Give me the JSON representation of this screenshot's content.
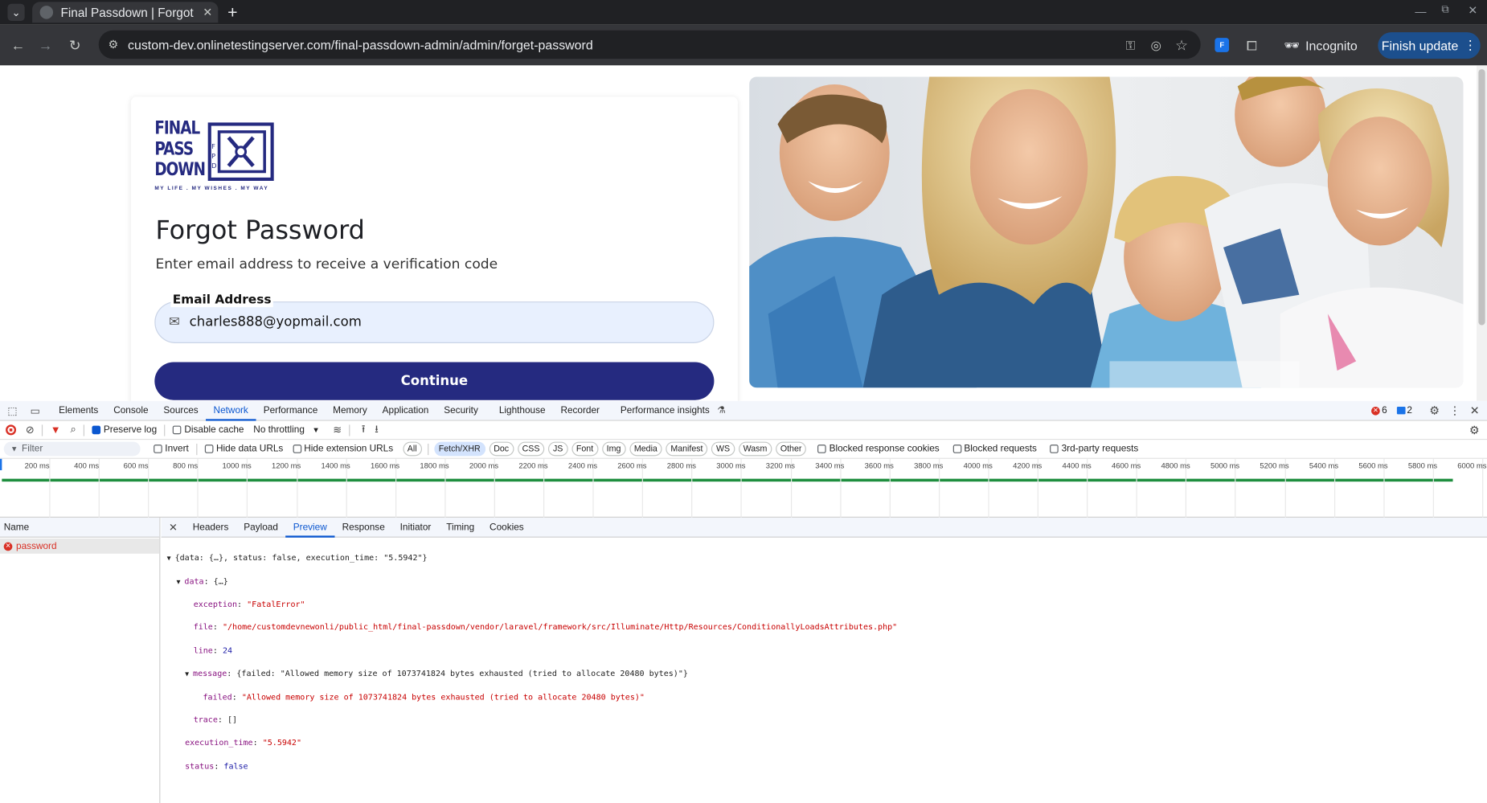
{
  "browser": {
    "tab_title": "Final Passdown | Forgot P",
    "url": "custom-dev.onlinetestingserver.com/final-passdown-admin/admin/forget-password",
    "incognito_label": "Incognito",
    "finish_update_label": "Finish update"
  },
  "page": {
    "logo": {
      "line1": "FINAL",
      "line2": "PASS",
      "line3": "DOWN",
      "tagline": "MY LIFE . MY WISHES . MY WAY"
    },
    "title": "Forgot Password",
    "subtitle": "Enter email address to receive a verification code",
    "email_label": "Email Address",
    "email_value": "charles888@yopmail.com",
    "continue_label": "Continue"
  },
  "devtools": {
    "tabs": [
      "Elements",
      "Console",
      "Sources",
      "Network",
      "Performance",
      "Memory",
      "Application",
      "Security",
      "Lighthouse",
      "Recorder",
      "Performance insights"
    ],
    "active_tab": "Network",
    "errors_count": "6",
    "messages_count": "2",
    "preserve_log": "Preserve log",
    "disable_cache": "Disable cache",
    "throttling": "No throttling",
    "filter_placeholder": "Filter",
    "invert": "Invert",
    "hide_data_urls": "Hide data URLs",
    "hide_extension_urls": "Hide extension URLs",
    "type_filters": [
      "All",
      "Fetch/XHR",
      "Doc",
      "CSS",
      "JS",
      "Font",
      "Img",
      "Media",
      "Manifest",
      "WS",
      "Wasm",
      "Other"
    ],
    "selected_type": "Fetch/XHR",
    "blocked_response_cookies": "Blocked response cookies",
    "blocked_requests": "Blocked requests",
    "third_party": "3rd-party requests",
    "timeline_ticks": [
      "200 ms",
      "400 ms",
      "600 ms",
      "800 ms",
      "1000 ms",
      "1200 ms",
      "1400 ms",
      "1600 ms",
      "1800 ms",
      "2000 ms",
      "2200 ms",
      "2400 ms",
      "2600 ms",
      "2800 ms",
      "3000 ms",
      "3200 ms",
      "3400 ms",
      "3600 ms",
      "3800 ms",
      "4000 ms",
      "4200 ms",
      "4400 ms",
      "4600 ms",
      "4800 ms",
      "5000 ms",
      "5200 ms",
      "5400 ms",
      "5600 ms",
      "5800 ms",
      "6000 ms"
    ],
    "name_header": "Name",
    "request_name": "password",
    "detail_tabs": [
      "Headers",
      "Payload",
      "Preview",
      "Response",
      "Initiator",
      "Timing",
      "Cookies"
    ],
    "detail_active": "Preview",
    "preview": {
      "root_summary": "{data: {…}, status: false, execution_time: \"5.5942\"}",
      "data_summary": "{…}",
      "exception": "\"FatalError\"",
      "file": "\"/home/customdevnewonli/public_html/final-passdown/vendor/laravel/framework/src/Illuminate/Http/Resources/ConditionallyLoadsAttributes.php\"",
      "line": "24",
      "message_summary": "{failed: \"Allowed memory size of 1073741824 bytes exhausted (tried to allocate 20480 bytes)\"}",
      "failed": "\"Allowed memory size of 1073741824 bytes exhausted (tried to allocate 20480 bytes)\"",
      "trace": "[]",
      "execution_time": "\"5.5942\"",
      "status": "false"
    }
  },
  "colors": {
    "brand": "#252a80",
    "accent": "#0b57d0",
    "error": "#d93025"
  }
}
